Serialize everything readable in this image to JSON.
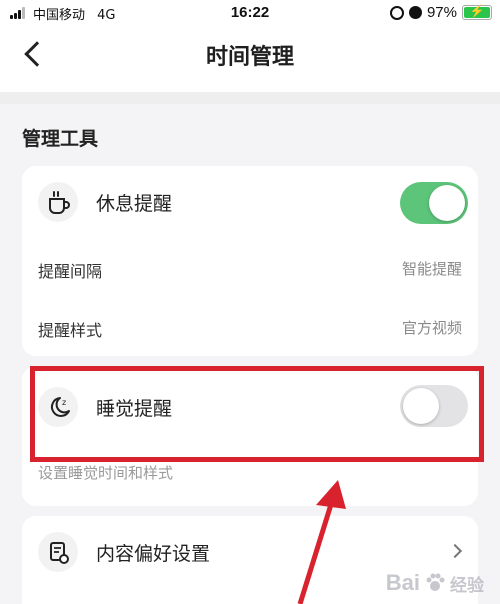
{
  "status_bar": {
    "carrier": "中国移动",
    "network": "4G",
    "time": "16:22",
    "battery": "97%"
  },
  "nav": {
    "title": "时间管理"
  },
  "section": {
    "title": "管理工具"
  },
  "rest_reminder": {
    "label": "休息提醒",
    "enabled": true,
    "icon": "coffee-cup-icon",
    "interval_label": "提醒间隔",
    "interval_value": "智能提醒",
    "style_label": "提醒样式",
    "style_value": "官方视频"
  },
  "sleep_reminder": {
    "label": "睡觉提醒",
    "enabled": false,
    "icon": "moon-icon",
    "hint": "设置睡觉时间和样式"
  },
  "content_preference": {
    "label": "内容偏好设置",
    "icon": "document-settings-icon"
  },
  "watermark": {
    "brand": "Bai",
    "brand_suffix": "经验"
  },
  "colors": {
    "toggle_on": "#5cc57a",
    "toggle_off": "#e3e3e5",
    "highlight": "#d8232f",
    "battery": "#2ac64b"
  }
}
